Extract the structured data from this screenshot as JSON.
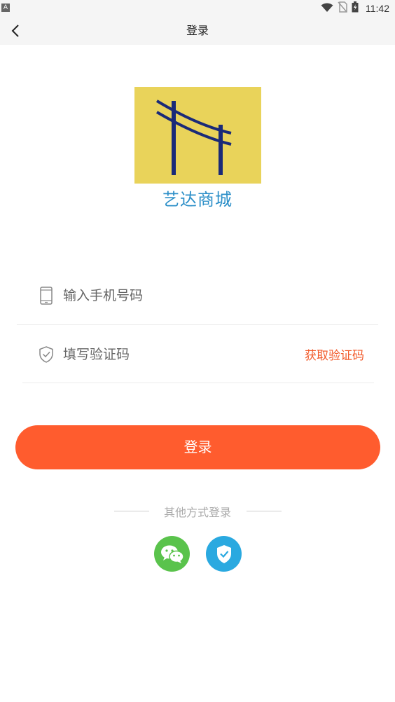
{
  "status_bar": {
    "left_badge": "A",
    "time": "11:42",
    "icons": [
      "wifi-icon",
      "no-sim-icon",
      "battery-charging-icon"
    ]
  },
  "nav": {
    "title": "登录",
    "back_icon": "chevron-left-icon"
  },
  "logo": {
    "app_name": "艺达商城",
    "colors": {
      "background": "#e9d35a",
      "poles": "#1a2a78",
      "name": "#2c8fc8"
    }
  },
  "form": {
    "phone": {
      "placeholder": "输入手机号码",
      "value": "",
      "icon": "phone-icon"
    },
    "code": {
      "placeholder": "填写验证码",
      "value": "",
      "icon": "shield-check-icon"
    },
    "get_code_label": "获取验证码"
  },
  "login_button": {
    "label": "登录",
    "color": "#ff5c2e"
  },
  "other_login": {
    "label": "其他方式登录",
    "options": [
      {
        "name": "wechat",
        "icon": "wechat-icon",
        "color": "#5ac34c"
      },
      {
        "name": "shield",
        "icon": "shield-check-icon",
        "color": "#2aa9e0"
      }
    ]
  }
}
